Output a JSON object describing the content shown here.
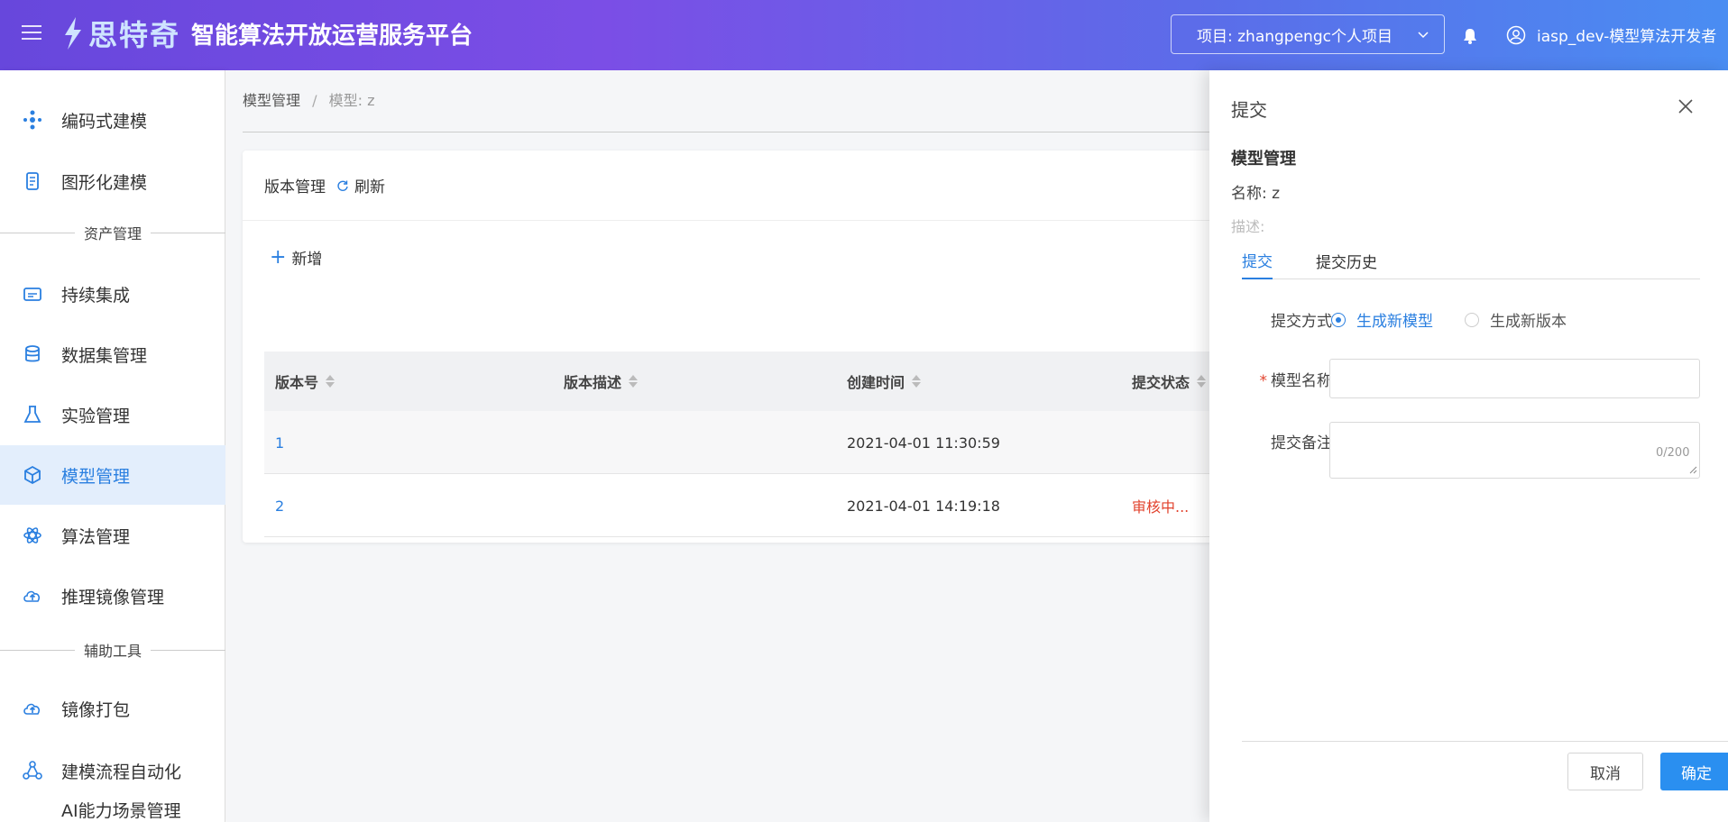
{
  "header": {
    "brand": "思特奇",
    "title": "智能算法开放运营服务平台",
    "project": "项目: zhangpengc个人项目",
    "user": "iasp_dev-模型算法开发者"
  },
  "sidebar": {
    "items_top": [
      {
        "label": "编码式建模",
        "icon": "coding-model-icon"
      },
      {
        "label": "图形化建模",
        "icon": "graphic-model-icon"
      }
    ],
    "group1": "资产管理",
    "items_assets": [
      {
        "label": "持续集成",
        "icon": "ci-icon"
      },
      {
        "label": "数据集管理",
        "icon": "database-icon"
      },
      {
        "label": "实验管理",
        "icon": "flask-icon"
      },
      {
        "label": "模型管理",
        "icon": "cube-icon",
        "active": true
      },
      {
        "label": "算法管理",
        "icon": "atom-icon"
      },
      {
        "label": "推理镜像管理",
        "icon": "cloud-image-icon"
      }
    ],
    "group2": "辅助工具",
    "items_tools": [
      {
        "label": "镜像打包",
        "icon": "cloud-pack-icon"
      },
      {
        "label": "建模流程自动化",
        "icon": "workflow-icon"
      },
      {
        "label": "AI能力场景管理",
        "icon": "scene-icon"
      }
    ]
  },
  "breadcrumb": {
    "root": "模型管理",
    "sep": "/",
    "current": "模型: z"
  },
  "version_panel": {
    "title": "版本管理",
    "refresh": "刷新",
    "add": "新增",
    "columns": [
      "版本号",
      "版本描述",
      "创建时间",
      "提交状态"
    ],
    "rows": [
      {
        "version": "1",
        "desc": "",
        "created": "2021-04-01 11:30:59",
        "status": ""
      },
      {
        "version": "2",
        "desc": "",
        "created": "2021-04-01 14:19:18",
        "status": "审核中..."
      }
    ]
  },
  "drawer": {
    "title": "提交",
    "section": "模型管理",
    "name": "名称: z",
    "desc": "描述:",
    "tabs": [
      "提交",
      "提交历史"
    ],
    "submit_mode_label": "提交方式",
    "options": [
      "生成新模型",
      "生成新版本"
    ],
    "selected_option": "生成新模型",
    "model_name_label": "模型名称",
    "model_name_value": "",
    "remark_label": "提交备注",
    "remark_value": "",
    "remark_count": "0/200",
    "cancel": "取消",
    "confirm": "确定"
  },
  "colors": {
    "accent": "#2a7fe0",
    "danger": "#e2432e",
    "header_start": "#6747dc",
    "header_end": "#4a8df2"
  }
}
